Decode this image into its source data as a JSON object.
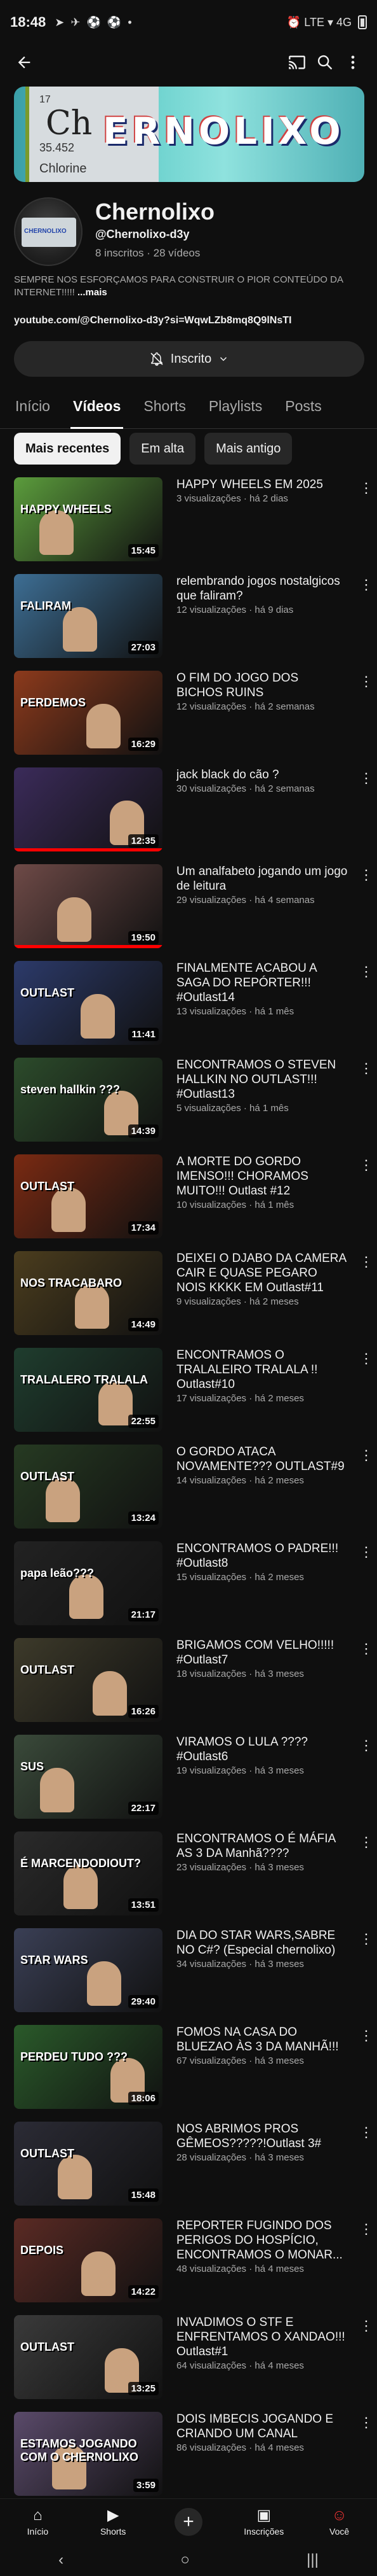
{
  "status_bar": {
    "time": "18:48",
    "right_icons": "⏰ LTE ▾ 4G"
  },
  "channel": {
    "banner": {
      "element_number": "17",
      "symbol": "Ch",
      "mass": "35.452",
      "element_name": "Chlorine",
      "logo": "ERNOLIXO"
    },
    "name": "Chernolixo",
    "handle": "@Chernolixo-d3y",
    "stats": "8 inscritos · 28 vídeos",
    "description": "SEMPRE NOS ESFORÇAMOS PARA CONSTRUIR O PIOR CONTEÚDO DA INTERNET!!!!!",
    "more_label": "...mais",
    "link": "youtube.com/@Chernolixo-d3y?si=WqwLZb8mq8Q9lNsTI",
    "subscribe_label": "Inscrito"
  },
  "tabs": [
    {
      "label": "Início"
    },
    {
      "label": "Vídeos"
    },
    {
      "label": "Shorts"
    },
    {
      "label": "Playlists"
    },
    {
      "label": "Posts"
    }
  ],
  "chips": [
    {
      "label": "Mais recentes"
    },
    {
      "label": "Em alta"
    },
    {
      "label": "Mais antigo"
    }
  ],
  "videos": [
    {
      "title": "HAPPY WHEELS EM 2025",
      "meta": "3 visualizações · há 2 dias",
      "duration": "15:45",
      "thumb_text": "HAPPY WHEELS",
      "color": "#5b9c3c",
      "progress": 0
    },
    {
      "title": "relembrando jogos nostalgicos que faliram?",
      "meta": "12 visualizações · há 9 dias",
      "duration": "27:03",
      "thumb_text": "FALIRAM",
      "color": "#3d6e94",
      "progress": 0
    },
    {
      "title": "O FIM DO JOGO DOS BICHOS RUINS",
      "meta": "12 visualizações · há 2 semanas",
      "duration": "16:29",
      "thumb_text": "PERDEMOS",
      "color": "#8c3a1c",
      "progress": 0
    },
    {
      "title": "jack black do cão ?",
      "meta": "30 visualizações · há 2 semanas",
      "duration": "12:35",
      "thumb_text": "",
      "color": "#3b2b5a",
      "progress": 1
    },
    {
      "title": "Um analfabeto jogando um jogo de leitura",
      "meta": "29 visualizações · há 4 semanas",
      "duration": "19:50",
      "thumb_text": "",
      "color": "#6e4a47",
      "progress": 1
    },
    {
      "title": "FINALMENTE ACABOU A SAGA DO REPÓRTER!!! #Outlast14",
      "meta": "13 visualizações · há 1 mês",
      "duration": "11:41",
      "thumb_text": "OUTLAST",
      "color": "#2c3a6a",
      "progress": 0
    },
    {
      "title": "ENCONTRAMOS O STEVEN HALLKIN NO OUTLAST!!! #Outlast13",
      "meta": "5 visualizações · há 1 mês",
      "duration": "14:39",
      "thumb_text": "steven hallkin ???",
      "color": "#2c4b2b",
      "progress": 0
    },
    {
      "title": "A MORTE DO GORDO IMENSO!!! CHORAMOS MUITO!!! Outlast #12",
      "meta": "10 visualizações · há 1 mês",
      "duration": "17:34",
      "thumb_text": "OUTLAST",
      "color": "#7a2a12",
      "progress": 0
    },
    {
      "title": "DEIXEI O DJABO DA CAMERA CAIR E QUASE PEGARO NOIS KKKK EM Outlast#11",
      "meta": "9 visualizações · há 2 meses",
      "duration": "14:49",
      "thumb_text": "NOS TRACABARO",
      "color": "#4b3d1e",
      "progress": 0
    },
    {
      "title": "ENCONTRAMOS O TRALALEIRO TRALALA !! Outlast#10",
      "meta": "17 visualizações · há 2 meses",
      "duration": "22:55",
      "thumb_text": "TRALALERO TRALALA",
      "color": "#1f3d2e",
      "progress": 0
    },
    {
      "title": "O GORDO ATACA NOVAMENTE??? OUTLAST#9",
      "meta": "14 visualizações · há 2 meses",
      "duration": "13:24",
      "thumb_text": "OUTLAST",
      "color": "#263a22",
      "progress": 0
    },
    {
      "title": "ENCONTRAMOS O PADRE!!! #Outlast8",
      "meta": "15 visualizações · há 2 meses",
      "duration": "21:17",
      "thumb_text": "papa leão???",
      "color": "#222",
      "progress": 0
    },
    {
      "title": "BRIGAMOS COM VELHO!!!!! #Outlast7",
      "meta": "18 visualizações · há 3 meses",
      "duration": "16:26",
      "thumb_text": "OUTLAST",
      "color": "#3d3a2a",
      "progress": 0
    },
    {
      "title": "VIRAMOS O LULA ???? #Outlast6",
      "meta": "19 visualizações · há 3 meses",
      "duration": "22:17",
      "thumb_text": "SUS",
      "color": "#3a4a3a",
      "progress": 0
    },
    {
      "title": "ENCONTRAMOS O É MÁFIA AS 3 DA Manhã????",
      "meta": "23 visualizações · há 3 meses",
      "duration": "13:51",
      "thumb_text": "É MARCENDODIOUT?",
      "color": "#2a2a2a",
      "progress": 0
    },
    {
      "title": "DIA DO STAR WARS,SABRE NO C#? (Especial chernolixo)",
      "meta": "34 visualizações · há 3 meses",
      "duration": "29:40",
      "thumb_text": "STAR WARS",
      "color": "#3a3f55",
      "progress": 0
    },
    {
      "title": "FOMOS NA CASA DO BLUEZAO ÀS 3 DA MANHÃ!!!",
      "meta": "67 visualizações · há 3 meses",
      "duration": "18:06",
      "thumb_text": "PERDEU TUDO ???",
      "color": "#2a5a2a",
      "progress": 0
    },
    {
      "title": "NOS ABRIMOS PROS GÊMEOS?????!Outlast 3#",
      "meta": "28 visualizações · há 3 meses",
      "duration": "15:48",
      "thumb_text": "OUTLAST",
      "color": "#2b2b35",
      "progress": 0
    },
    {
      "title": "REPORTER FUGINDO DOS PERIGOS DO HOSPÍCIO, ENCONTRAMOS O MONAR...",
      "meta": "48 visualizações · há 4 meses",
      "duration": "14:22",
      "thumb_text": "DEPOIS",
      "color": "#5a2a24",
      "progress": 0
    },
    {
      "title": "INVADIMOS O STF E ENFRENTAMOS O XANDAO!!! Outlast#1",
      "meta": "64 visualizações · há 4 meses",
      "duration": "13:25",
      "thumb_text": "OUTLAST",
      "color": "#3a3a3a",
      "progress": 0
    },
    {
      "title": "DOIS IMBECIS JOGANDO E CRIANDO UM CANAL",
      "meta": "86 visualizações · há 4 meses",
      "duration": "3:59",
      "thumb_text": "ESTAMOS JOGANDO COM O CHERNOLIXO",
      "color": "#5a4a6a",
      "progress": 0
    }
  ],
  "bottom_nav": [
    {
      "label": "Início",
      "icon": "home-icon"
    },
    {
      "label": "Shorts",
      "icon": "shorts-icon"
    },
    {
      "label": "",
      "icon": "add-icon"
    },
    {
      "label": "Inscrições",
      "icon": "subscriptions-icon"
    },
    {
      "label": "Você",
      "icon": "profile-icon"
    }
  ]
}
